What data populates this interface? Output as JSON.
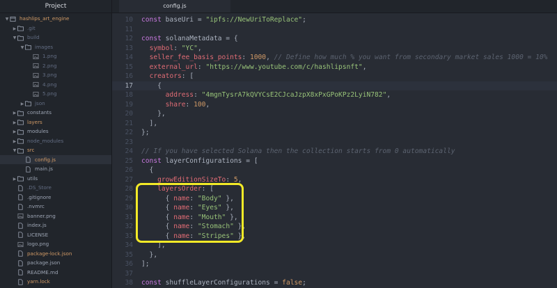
{
  "sidebar": {
    "title": "Project",
    "items": [
      {
        "label": "hashlips_art_engine",
        "type": "root",
        "open": true,
        "depth": 0,
        "status": "modified"
      },
      {
        "label": ".git",
        "type": "folder",
        "open": false,
        "depth": 1,
        "status": "ignored"
      },
      {
        "label": "build",
        "type": "folder",
        "open": true,
        "depth": 1,
        "status": "ignored"
      },
      {
        "label": "images",
        "type": "folder",
        "open": true,
        "depth": 2,
        "status": "ignored"
      },
      {
        "label": "1.png",
        "type": "image",
        "depth": 3,
        "status": "ignored"
      },
      {
        "label": "2.png",
        "type": "image",
        "depth": 3,
        "status": "ignored"
      },
      {
        "label": "3.png",
        "type": "image",
        "depth": 3,
        "status": "ignored"
      },
      {
        "label": "4.png",
        "type": "image",
        "depth": 3,
        "status": "ignored"
      },
      {
        "label": "5.png",
        "type": "image",
        "depth": 3,
        "status": "ignored"
      },
      {
        "label": "json",
        "type": "folder",
        "open": false,
        "depth": 2,
        "status": "ignored"
      },
      {
        "label": "constants",
        "type": "folder",
        "open": false,
        "depth": 1,
        "status": "normal"
      },
      {
        "label": "layers",
        "type": "folder",
        "open": false,
        "depth": 1,
        "status": "modified"
      },
      {
        "label": "modules",
        "type": "folder",
        "open": false,
        "depth": 1,
        "status": "normal"
      },
      {
        "label": "node_modules",
        "type": "folder",
        "open": false,
        "depth": 1,
        "status": "ignored"
      },
      {
        "label": "src",
        "type": "folder",
        "open": true,
        "depth": 1,
        "status": "modified"
      },
      {
        "label": "config.js",
        "type": "file",
        "depth": 2,
        "status": "modified",
        "selected": true
      },
      {
        "label": "main.js",
        "type": "file",
        "depth": 2,
        "status": "normal"
      },
      {
        "label": "utils",
        "type": "folder",
        "open": false,
        "depth": 1,
        "status": "normal"
      },
      {
        "label": ".DS_Store",
        "type": "file",
        "depth": 1,
        "status": "ignored"
      },
      {
        "label": ".gitignore",
        "type": "file",
        "depth": 1,
        "status": "normal"
      },
      {
        "label": ".nvmrc",
        "type": "file",
        "depth": 1,
        "status": "normal"
      },
      {
        "label": "banner.png",
        "type": "image",
        "depth": 1,
        "status": "normal"
      },
      {
        "label": "index.js",
        "type": "file",
        "depth": 1,
        "status": "normal"
      },
      {
        "label": "LICENSE",
        "type": "file",
        "depth": 1,
        "status": "normal"
      },
      {
        "label": "logo.png",
        "type": "image",
        "depth": 1,
        "status": "normal"
      },
      {
        "label": "package-lock.json",
        "type": "file",
        "depth": 1,
        "status": "modified"
      },
      {
        "label": "package.json",
        "type": "file",
        "depth": 1,
        "status": "normal"
      },
      {
        "label": "README.md",
        "type": "file",
        "depth": 1,
        "status": "normal"
      },
      {
        "label": "yarn.lock",
        "type": "file",
        "depth": 1,
        "status": "modified"
      }
    ]
  },
  "editor": {
    "tab_label": "config.js",
    "cursor_line": 17,
    "lines": [
      {
        "n": "10",
        "tokens": [
          [
            "kw",
            "const "
          ],
          [
            "var",
            "baseUri "
          ],
          [
            "punc",
            "= "
          ],
          [
            "str",
            "\"ipfs://NewUriToReplace\""
          ],
          [
            "punc",
            ";"
          ]
        ]
      },
      {
        "n": "11",
        "tokens": []
      },
      {
        "n": "12",
        "tokens": [
          [
            "kw",
            "const "
          ],
          [
            "var",
            "solanaMetadata "
          ],
          [
            "punc",
            "= {"
          ]
        ]
      },
      {
        "n": "13",
        "tokens": [
          [
            "punc",
            "  "
          ],
          [
            "prop",
            "symbol"
          ],
          [
            "punc",
            ": "
          ],
          [
            "str",
            "\"YC\""
          ],
          [
            "punc",
            ","
          ]
        ]
      },
      {
        "n": "14",
        "tokens": [
          [
            "punc",
            "  "
          ],
          [
            "prop",
            "seller_fee_basis_points"
          ],
          [
            "punc",
            ": "
          ],
          [
            "num",
            "1000"
          ],
          [
            "punc",
            ", "
          ],
          [
            "cm",
            "// Define how much % you want from secondary market sales 1000 = 10%"
          ]
        ]
      },
      {
        "n": "15",
        "tokens": [
          [
            "punc",
            "  "
          ],
          [
            "prop",
            "external_url"
          ],
          [
            "punc",
            ": "
          ],
          [
            "str",
            "\"https://www.youtube.com/c/hashlipsnft\""
          ],
          [
            "punc",
            ","
          ]
        ]
      },
      {
        "n": "16",
        "tokens": [
          [
            "punc",
            "  "
          ],
          [
            "prop",
            "creators"
          ],
          [
            "punc",
            ": ["
          ]
        ]
      },
      {
        "n": "17",
        "tokens": [
          [
            "punc",
            "    {"
          ]
        ]
      },
      {
        "n": "18",
        "tokens": [
          [
            "punc",
            "      "
          ],
          [
            "prop",
            "address"
          ],
          [
            "punc",
            ": "
          ],
          [
            "str",
            "\"4mgnTysrA7kQVYCsE2CJcaJzpX8xPxGPoKPz2LyiN782\""
          ],
          [
            "punc",
            ","
          ]
        ]
      },
      {
        "n": "19",
        "tokens": [
          [
            "punc",
            "      "
          ],
          [
            "prop",
            "share"
          ],
          [
            "punc",
            ": "
          ],
          [
            "num",
            "100"
          ],
          [
            "punc",
            ","
          ]
        ]
      },
      {
        "n": "20",
        "tokens": [
          [
            "punc",
            "    },"
          ]
        ]
      },
      {
        "n": "21",
        "tokens": [
          [
            "punc",
            "  ],"
          ]
        ]
      },
      {
        "n": "22",
        "tokens": [
          [
            "punc",
            "};"
          ]
        ]
      },
      {
        "n": "23",
        "tokens": []
      },
      {
        "n": "24",
        "tokens": [
          [
            "cm",
            "// If you have selected Solana then the collection starts from 0 automatically"
          ]
        ]
      },
      {
        "n": "25",
        "tokens": [
          [
            "kw",
            "const "
          ],
          [
            "var",
            "layerConfigurations "
          ],
          [
            "punc",
            "= ["
          ]
        ]
      },
      {
        "n": "26",
        "tokens": [
          [
            "punc",
            "  {"
          ]
        ]
      },
      {
        "n": "27",
        "tokens": [
          [
            "punc",
            "    "
          ],
          [
            "prop",
            "growEditionSizeTo"
          ],
          [
            "punc",
            ": "
          ],
          [
            "num",
            "5"
          ],
          [
            "punc",
            ","
          ]
        ]
      },
      {
        "n": "28",
        "tokens": [
          [
            "punc",
            "    "
          ],
          [
            "prop",
            "layersOrder"
          ],
          [
            "punc",
            ": ["
          ]
        ]
      },
      {
        "n": "29",
        "tokens": [
          [
            "punc",
            "      { "
          ],
          [
            "prop",
            "name"
          ],
          [
            "punc",
            ": "
          ],
          [
            "str",
            "\"Body\""
          ],
          [
            "punc",
            " },"
          ]
        ]
      },
      {
        "n": "30",
        "tokens": [
          [
            "punc",
            "      { "
          ],
          [
            "prop",
            "name"
          ],
          [
            "punc",
            ": "
          ],
          [
            "str",
            "\"Eyes\""
          ],
          [
            "punc",
            " },"
          ]
        ]
      },
      {
        "n": "31",
        "tokens": [
          [
            "punc",
            "      { "
          ],
          [
            "prop",
            "name"
          ],
          [
            "punc",
            ": "
          ],
          [
            "str",
            "\"Mouth\""
          ],
          [
            "punc",
            " },"
          ]
        ]
      },
      {
        "n": "32",
        "tokens": [
          [
            "punc",
            "      { "
          ],
          [
            "prop",
            "name"
          ],
          [
            "punc",
            ": "
          ],
          [
            "str",
            "\"Stomach\""
          ],
          [
            "punc",
            " },"
          ]
        ]
      },
      {
        "n": "33",
        "tokens": [
          [
            "punc",
            "      { "
          ],
          [
            "prop",
            "name"
          ],
          [
            "punc",
            ": "
          ],
          [
            "str",
            "\"Stripes\""
          ],
          [
            "punc",
            " },"
          ]
        ]
      },
      {
        "n": "34",
        "tokens": [
          [
            "punc",
            "    ],"
          ]
        ]
      },
      {
        "n": "35",
        "tokens": [
          [
            "punc",
            "  },"
          ]
        ]
      },
      {
        "n": "36",
        "tokens": [
          [
            "punc",
            "];"
          ]
        ]
      },
      {
        "n": "37",
        "tokens": []
      },
      {
        "n": "38",
        "tokens": [
          [
            "kw",
            "const "
          ],
          [
            "var",
            "shuffleLayerConfigurations "
          ],
          [
            "punc",
            "= "
          ],
          [
            "bool",
            "false"
          ],
          [
            "punc",
            ";"
          ]
        ]
      }
    ]
  },
  "colors": {
    "highlight_box": "#f3ea27",
    "modified": "#d19a66",
    "background": "#282c34",
    "sidebar": "#21252b"
  }
}
